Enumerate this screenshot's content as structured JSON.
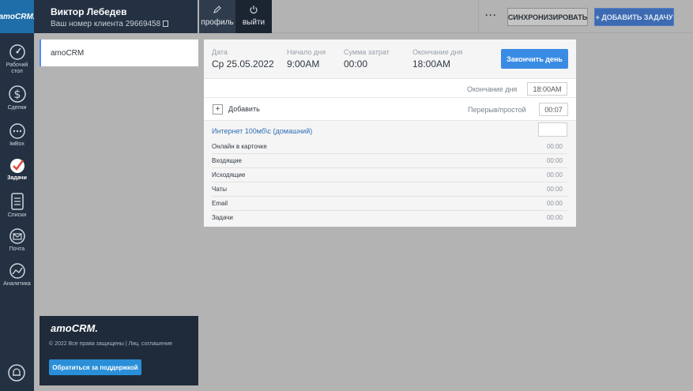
{
  "brand": {
    "logo_text": "amoCRM."
  },
  "nav": {
    "items": [
      {
        "label": "Рабочий стол",
        "icon": "dashboard-icon"
      },
      {
        "label": "Сделки",
        "icon": "dollar-icon"
      },
      {
        "label": "IмBox",
        "icon": "chat-icon"
      },
      {
        "label": "Задачи",
        "icon": "task-check-icon"
      },
      {
        "label": "Списки",
        "icon": "list-icon"
      },
      {
        "label": "Почта",
        "icon": "mail-icon"
      },
      {
        "label": "Аналитика",
        "icon": "analytics-icon"
      }
    ],
    "active": "Задачи"
  },
  "header": {
    "user_name": "Виктор Лебедев",
    "client_number": "Ваш номер клиента 29669458",
    "profile_label": "профиль",
    "exit_label": "выйти",
    "more_label": "···",
    "sync_label": "СИНХРОНИЗИРОВАТЬ",
    "add_task_label": "+ ДОБАВИТЬ ЗАДАЧУ"
  },
  "left_panel": {
    "tab_label": "amoCRM"
  },
  "footer": {
    "logo_text": "amoCRM.",
    "copyright": "© 2022 Все права защищены | Лиц. соглашение",
    "support_label": "Обратиться за поддержкой"
  },
  "workday": {
    "date_label": "Дата",
    "date_value": "Ср 25.05.2022",
    "start_label": "Начало дня",
    "start_value": "9:00AM",
    "cost_label": "Сумма затрат",
    "cost_value": "00:00",
    "end_label": "Окончание дня",
    "end_value": "18:00AM",
    "finish_button": "Закончить день",
    "end_row_label": "Окончание дня",
    "end_row_value": "18:00AM",
    "add_label": "Добавить",
    "add_box": "+",
    "break_label": "Перерыв/простой",
    "break_value": "00:07"
  },
  "group": {
    "title": "Интернет 100мб\\с (домашний)",
    "rows": [
      {
        "label": "Онлайн в карточке",
        "value": "00:00"
      },
      {
        "label": "Входящие",
        "value": "00:00"
      },
      {
        "label": "Исходящие",
        "value": "00:00"
      },
      {
        "label": "Чаты",
        "value": "00:00"
      },
      {
        "label": "Email",
        "value": "00:00"
      },
      {
        "label": "Задачи",
        "value": "00:00"
      }
    ]
  },
  "colors": {
    "nav_bg": "#243142",
    "accent_blue": "#3a8be4",
    "link_blue": "#2f6fb6",
    "overlay_gray": "#b3b3b3"
  }
}
